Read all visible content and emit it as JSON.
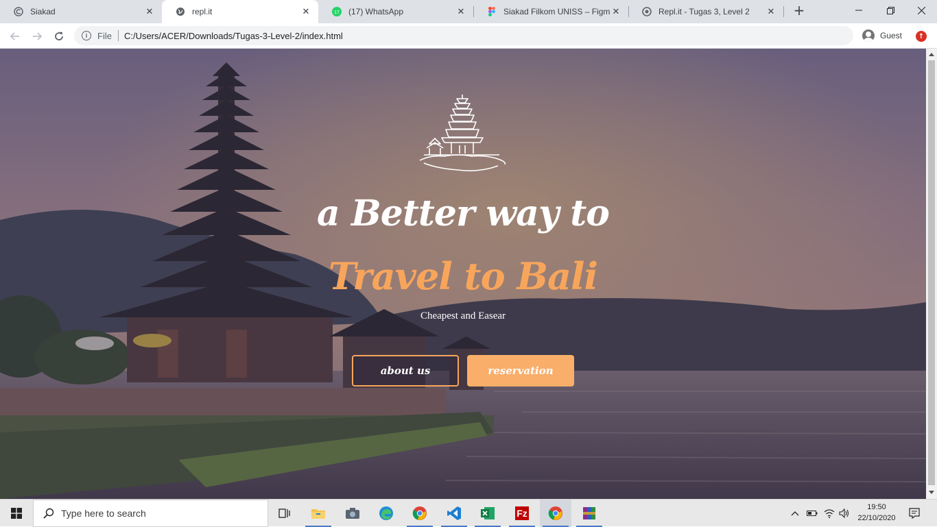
{
  "browser": {
    "tabs": [
      {
        "title": "Siakad",
        "icon": "circle-c-icon"
      },
      {
        "title": "repl.it",
        "icon": "globe-icon",
        "active": true
      },
      {
        "title": "(17) WhatsApp",
        "icon": "whatsapp-icon",
        "badge": "17"
      },
      {
        "title": "Siakad Filkom UNISS – Figma",
        "icon": "figma-icon"
      },
      {
        "title": "Repl.it - Tugas 3, Level 2",
        "icon": "replit-icon"
      }
    ],
    "new_tab": "+",
    "address": {
      "scheme_label": "File",
      "url": "C:/Users/ACER/Downloads/Tugas-3-Level-2/index.html"
    },
    "profile": {
      "label": "Guest"
    },
    "update_badge": "↑"
  },
  "page": {
    "headline_line1": "a Better way to",
    "headline_line2": "Travel to Bali",
    "subtitle": "Cheapest and Easear",
    "buttons": {
      "about": "about us",
      "reservation": "reservation"
    },
    "colors": {
      "accent": "#f8a55c",
      "button_fill": "#f9ae6a",
      "overlay": "rgba(40,35,60,0.35)"
    }
  },
  "taskbar": {
    "search_placeholder": "Type here to search",
    "apps": [
      "task-view-icon",
      "file-explorer-icon",
      "camera-icon",
      "edge-icon",
      "chrome-icon",
      "vscode-icon",
      "excel-icon",
      "filezilla-icon",
      "chrome-icon",
      "winrar-icon"
    ],
    "clock": {
      "time": "19:50",
      "date": "22/10/2020"
    }
  }
}
